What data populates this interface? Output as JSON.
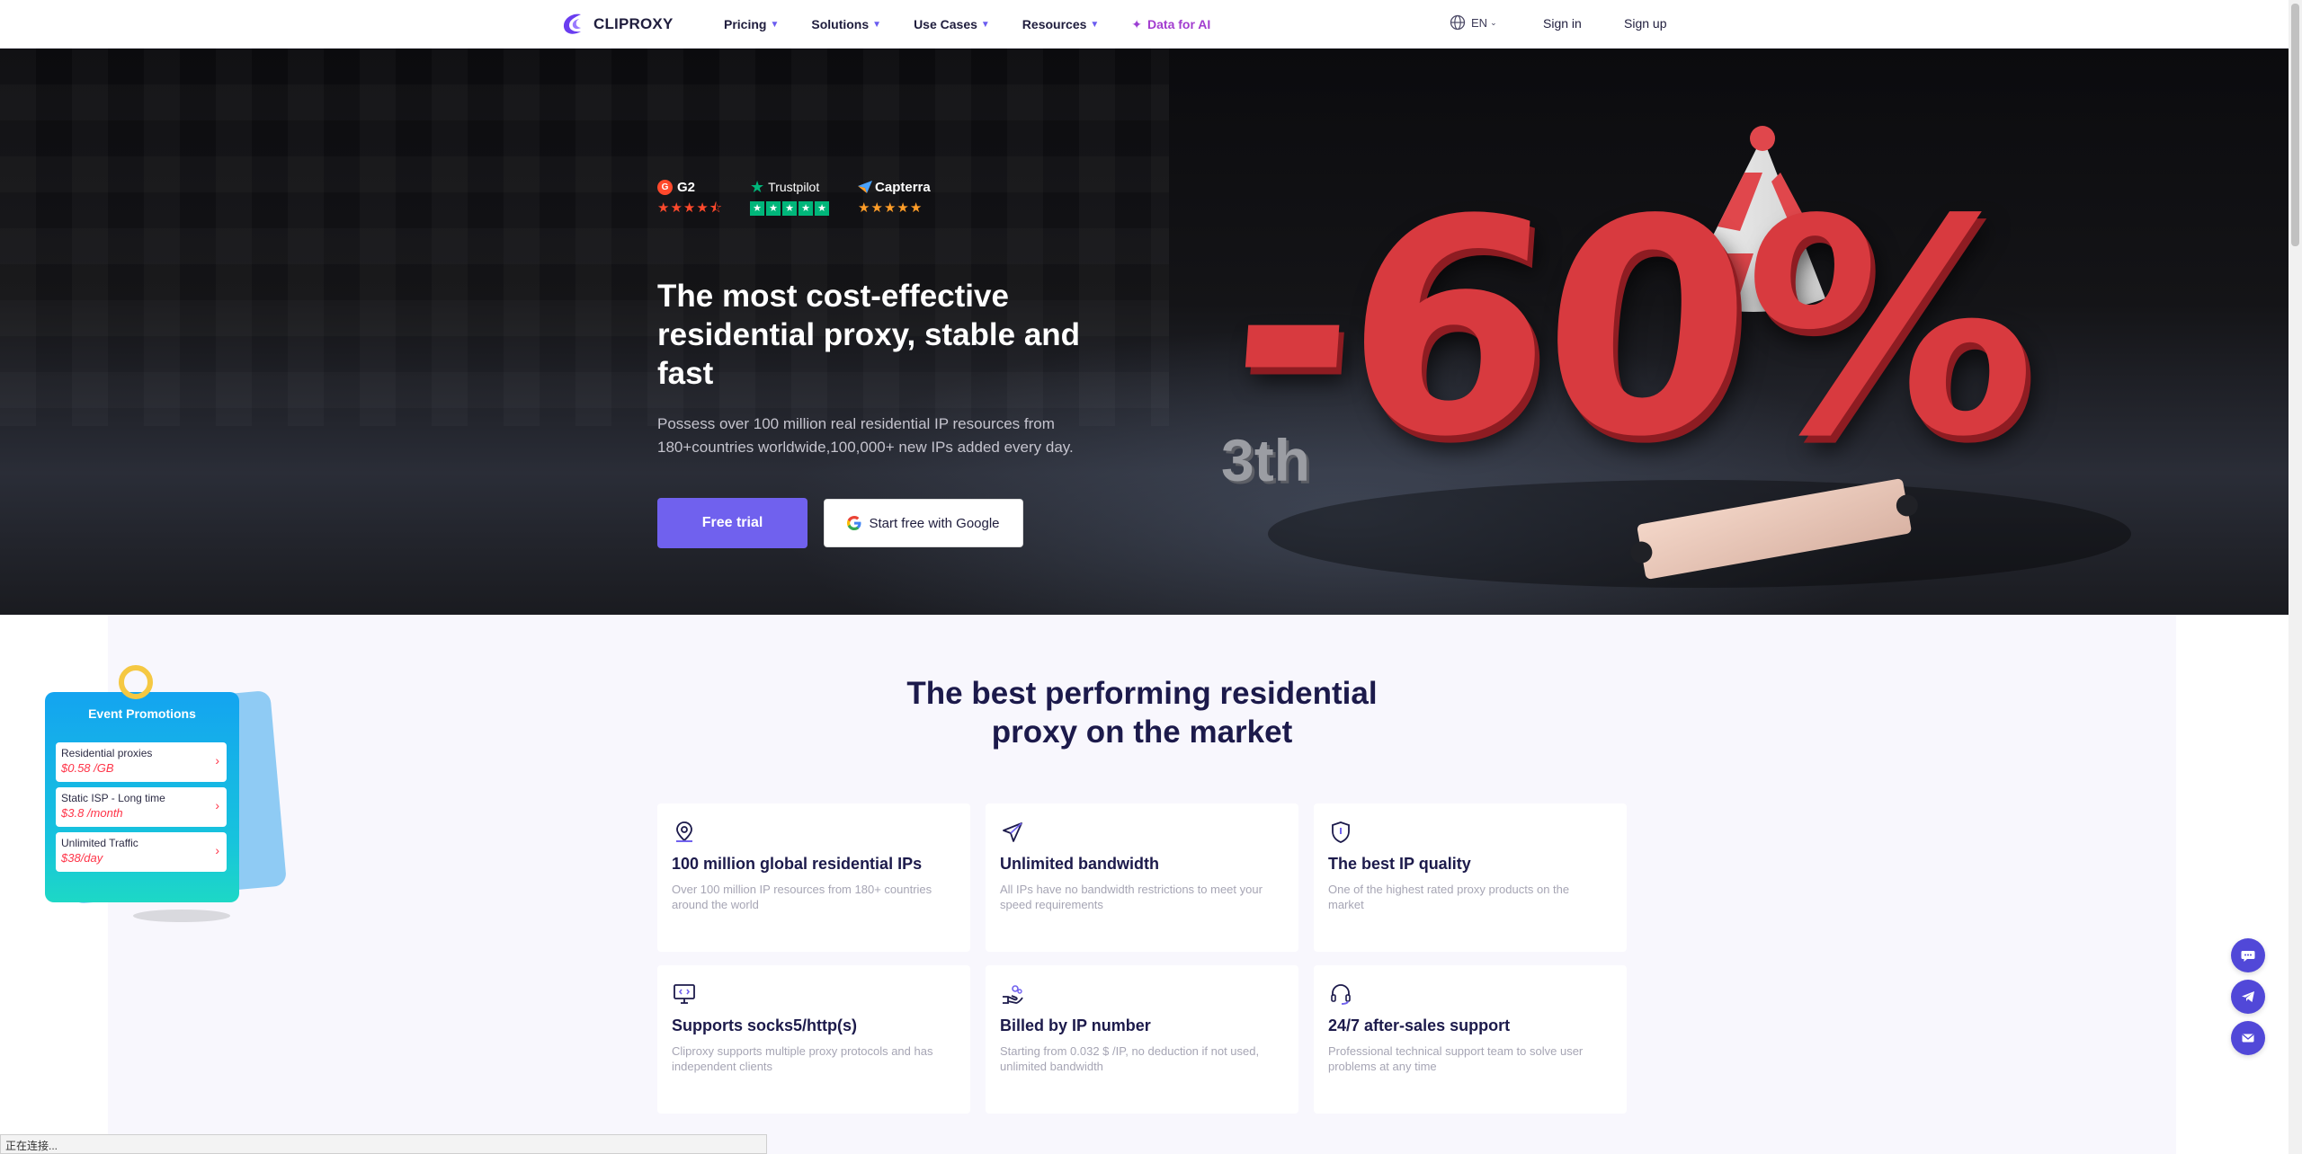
{
  "nav": {
    "brand": "CLIPROXY",
    "menu": [
      {
        "label": "Pricing"
      },
      {
        "label": "Solutions"
      },
      {
        "label": "Use Cases"
      },
      {
        "label": "Resources"
      }
    ],
    "ai_link": "Data for AI",
    "language": "EN",
    "sign_in": "Sign in",
    "sign_up": "Sign up"
  },
  "hero": {
    "ratings": [
      {
        "name": "G2",
        "stars": 4.5
      },
      {
        "name": "Trustpilot",
        "stars": 5
      },
      {
        "name": "Capterra",
        "stars": 5
      }
    ],
    "title": "The most cost-effective residential proxy, stable and fast",
    "subtitle": "Possess over 100 million real residential IP resources from 180+countries worldwide,100,000+ new IPs added every day.",
    "free_trial": "Free trial",
    "google_start": "Start free with Google",
    "promo_discount": "-60%",
    "promo_tag": "3th"
  },
  "features": {
    "title": "The best performing residential proxy on the market",
    "cards": [
      {
        "icon": "location-pin-icon",
        "title": "100 million global residential IPs",
        "desc": "Over 100 million IP resources from 180+ countries around the world"
      },
      {
        "icon": "paper-plane-icon",
        "title": "Unlimited bandwidth",
        "desc": "All IPs have no bandwidth restrictions to meet your speed requirements"
      },
      {
        "icon": "shield-icon",
        "title": "The best IP quality",
        "desc": "One of the highest rated proxy products on the market"
      },
      {
        "icon": "monitor-icon",
        "title": "Supports socks5/http(s)",
        "desc": "Cliproxy supports multiple proxy protocols and has independent clients"
      },
      {
        "icon": "hand-coin-icon",
        "title": "Billed by IP number",
        "desc": "Starting from 0.032 $ /IP, no deduction if not used, unlimited bandwidth"
      },
      {
        "icon": "headset-icon",
        "title": "24/7 after-sales support",
        "desc": "Professional technical support team to solve user problems at any time"
      }
    ]
  },
  "event": {
    "title": "Event Promotions",
    "items": [
      {
        "label": "Residential proxies",
        "price": "$0.58 /GB"
      },
      {
        "label": "Static ISP - Long time",
        "price": "$3.8 /month"
      },
      {
        "label": "Unlimited Traffic",
        "price": "$38/day"
      }
    ]
  },
  "status_text": "正在连接...",
  "colors": {
    "accent": "#7061ee",
    "ai_link": "#a23ccf",
    "promo_red": "#d83a3f",
    "contact_button": "#5148d8"
  }
}
